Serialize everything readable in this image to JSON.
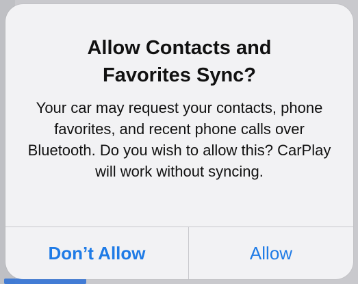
{
  "alert": {
    "title": "Allow Contacts and Favorites Sync?",
    "message": "Your car may request your contacts, phone favorites, and recent phone calls over Bluetooth. Do you wish to allow this? CarPlay will work without syncing.",
    "buttons": {
      "dont_allow": "Don’t Allow",
      "allow": "Allow"
    }
  },
  "colors": {
    "button_text": "#1f7be6",
    "alert_bg": "#f2f2f4"
  }
}
